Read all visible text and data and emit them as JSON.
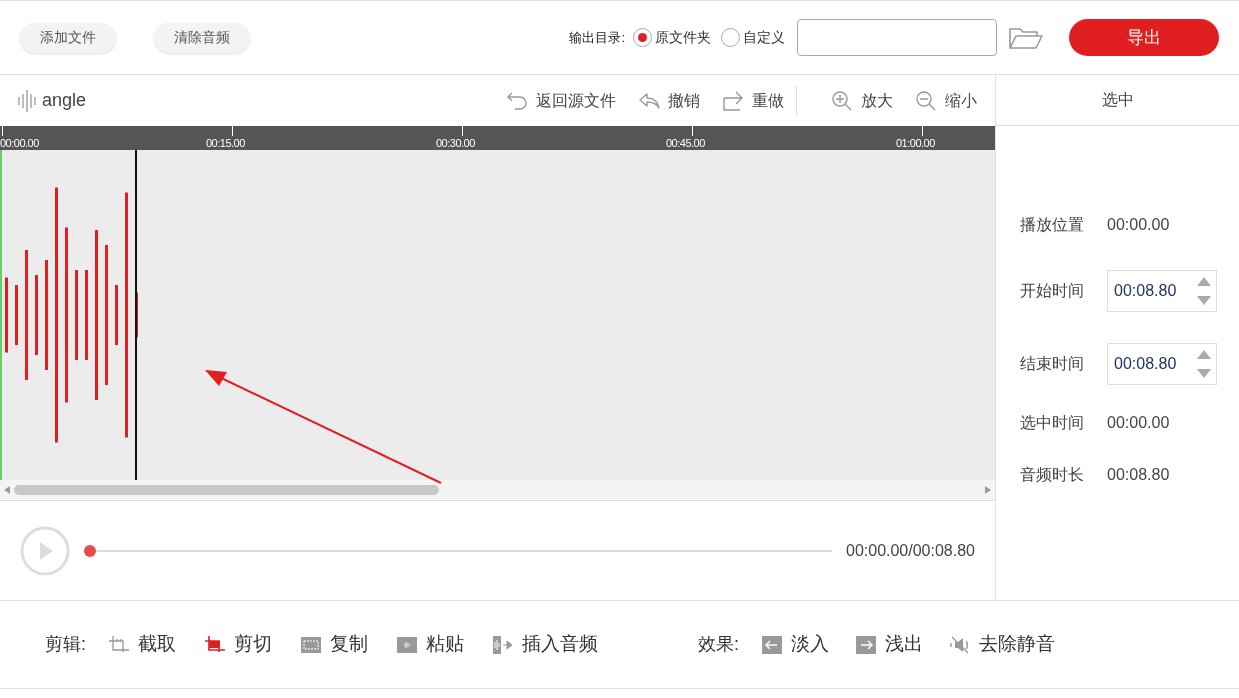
{
  "top_bar": {
    "buttons": [
      "添加文件",
      "清除音频"
    ],
    "output_label": "输出目录:",
    "output_options": [
      {
        "label": "原文件夹",
        "selected": true
      },
      {
        "label": "自定义",
        "selected": false
      }
    ],
    "export_button": "导出"
  },
  "editor_toolbar": {
    "file_name": "angle",
    "actions": [
      {
        "kind": "revert",
        "label": "返回源文件"
      },
      {
        "kind": "undo",
        "label": "撤销"
      },
      {
        "kind": "redo",
        "label": "重做"
      },
      {
        "kind": "zoom_in",
        "label": "放大"
      },
      {
        "kind": "zoom_out",
        "label": "缩小"
      }
    ]
  },
  "ruler": [
    "00:00.00",
    "00:15.00",
    "00:30.00",
    "00:45.00",
    "01:00.00"
  ],
  "player": {
    "level": 0,
    "time": "00:00.00/00:08.80"
  },
  "side_panel": {
    "title": "选中",
    "fields": [
      {
        "kind": "text",
        "label": "播放位置",
        "value": "00:00.00"
      },
      {
        "kind": "spin",
        "label": "开始时间",
        "value": "00:08.80"
      },
      {
        "kind": "spin",
        "label": "结束时间",
        "value": "00:08.80"
      },
      {
        "kind": "text",
        "label": "选中时间",
        "value": "00:00.00"
      },
      {
        "kind": "text",
        "label": "音频时长",
        "value": "00:08.80"
      }
    ]
  },
  "bottom_toolbar": {
    "edit_label": "剪辑:",
    "edit_tools": [
      {
        "kind": "trim",
        "label": "截取",
        "active": false
      },
      {
        "kind": "cut",
        "label": "剪切",
        "active": true
      },
      {
        "kind": "copy",
        "label": "复制",
        "active": false
      },
      {
        "kind": "paste",
        "label": "粘贴",
        "active": false
      },
      {
        "kind": "insert",
        "label": "插入音频",
        "active": false
      }
    ],
    "effects_label": "效果:",
    "effects": [
      {
        "kind": "fade_in",
        "label": "淡入"
      },
      {
        "kind": "fade_out",
        "label": "浅出"
      },
      {
        "kind": "mute",
        "label": "去除静音"
      }
    ]
  }
}
